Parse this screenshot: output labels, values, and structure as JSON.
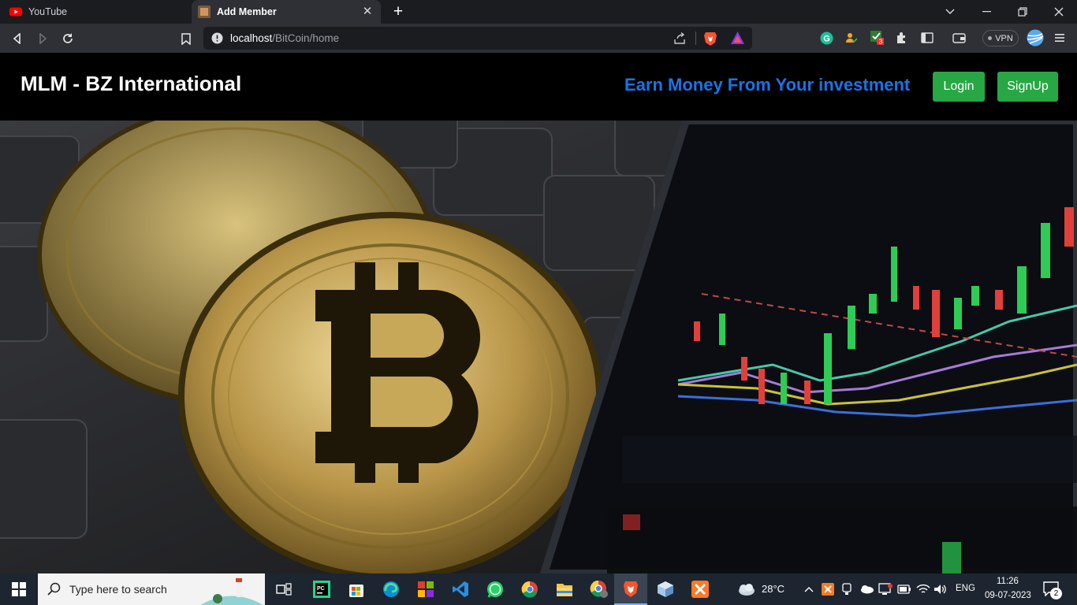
{
  "browser": {
    "tabs": [
      {
        "label": "YouTube",
        "active": false
      },
      {
        "label": "Add Member",
        "active": true
      }
    ],
    "url": {
      "host": "localhost",
      "path": "/BitCoin/home"
    },
    "vpn_label": "VPN",
    "extension_badge": "3"
  },
  "site": {
    "brand": "MLM - BZ International",
    "tagline": "Earn Money From Your investment",
    "login_label": "Login",
    "signup_label": "SignUp",
    "colors": {
      "tagline": "#1a73e8",
      "button": "#28a745",
      "background": "#000000"
    }
  },
  "taskbar": {
    "search_placeholder": "Type here to search",
    "weather_temp": "28°C",
    "language": "ENG",
    "time": "11:26",
    "date": "09-07-2023",
    "notification_count": "2"
  }
}
